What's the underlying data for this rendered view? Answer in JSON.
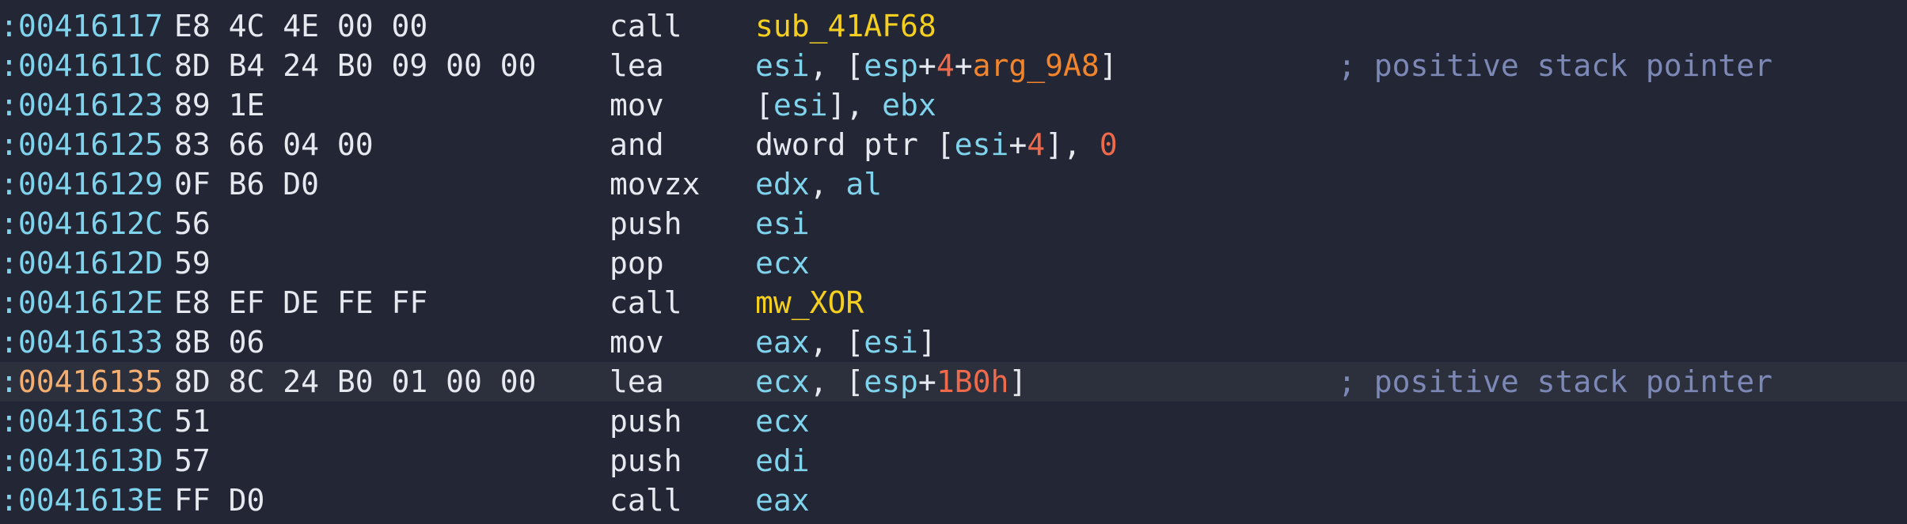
{
  "colors": {
    "background": "#232634",
    "highlight_row": "#2c303d",
    "address": "#7fd3ec",
    "address_current": "#f4ae71",
    "text": "#e7e9f0",
    "register": "#7fd3ec",
    "number": "#ee6a4b",
    "symbol": "#f4cf1f",
    "argument": "#f2842c",
    "comment": "#7c88b5"
  },
  "lines": [
    {
      "colon": ":",
      "address": "00416117",
      "bytes": "E8 4C 4E 00 00",
      "mnemonic": "call",
      "operands": [
        {
          "text": "sub_41AF68",
          "kind": "sym"
        }
      ],
      "comment": ""
    },
    {
      "colon": ":",
      "address": "0041611C",
      "bytes": "8D B4 24 B0 09 00 00",
      "mnemonic": "lea",
      "operands": [
        {
          "text": "esi",
          "kind": "reg"
        },
        {
          "text": ", [",
          "kind": "plain"
        },
        {
          "text": "esp",
          "kind": "reg"
        },
        {
          "text": "+",
          "kind": "plain"
        },
        {
          "text": "4",
          "kind": "num"
        },
        {
          "text": "+",
          "kind": "plain"
        },
        {
          "text": "arg_9A8",
          "kind": "arg"
        },
        {
          "text": "]",
          "kind": "plain"
        }
      ],
      "comment": "; positive stack pointer"
    },
    {
      "colon": ":",
      "address": "00416123",
      "bytes": "89 1E",
      "mnemonic": "mov",
      "operands": [
        {
          "text": "[",
          "kind": "plain"
        },
        {
          "text": "esi",
          "kind": "reg"
        },
        {
          "text": "], ",
          "kind": "plain"
        },
        {
          "text": "ebx",
          "kind": "reg"
        }
      ],
      "comment": ""
    },
    {
      "colon": ":",
      "address": "00416125",
      "bytes": "83 66 04 00",
      "mnemonic": "and",
      "operands": [
        {
          "text": "dword ptr [",
          "kind": "plain"
        },
        {
          "text": "esi",
          "kind": "reg"
        },
        {
          "text": "+",
          "kind": "plain"
        },
        {
          "text": "4",
          "kind": "num"
        },
        {
          "text": "], ",
          "kind": "plain"
        },
        {
          "text": "0",
          "kind": "num"
        }
      ],
      "comment": ""
    },
    {
      "colon": ":",
      "address": "00416129",
      "bytes": "0F B6 D0",
      "mnemonic": "movzx",
      "operands": [
        {
          "text": "edx",
          "kind": "reg"
        },
        {
          "text": ", ",
          "kind": "plain"
        },
        {
          "text": "al",
          "kind": "reg"
        }
      ],
      "comment": ""
    },
    {
      "colon": ":",
      "address": "0041612C",
      "bytes": "56",
      "mnemonic": "push",
      "operands": [
        {
          "text": "esi",
          "kind": "reg"
        }
      ],
      "comment": ""
    },
    {
      "colon": ":",
      "address": "0041612D",
      "bytes": "59",
      "mnemonic": "pop",
      "operands": [
        {
          "text": "ecx",
          "kind": "reg"
        }
      ],
      "comment": ""
    },
    {
      "colon": ":",
      "address": "0041612E",
      "bytes": "E8 EF DE FE FF",
      "mnemonic": "call",
      "operands": [
        {
          "text": "mw_XOR",
          "kind": "sym"
        }
      ],
      "comment": ""
    },
    {
      "colon": ":",
      "address": "00416133",
      "bytes": "8B 06",
      "mnemonic": "mov",
      "operands": [
        {
          "text": "eax",
          "kind": "reg"
        },
        {
          "text": ", [",
          "kind": "plain"
        },
        {
          "text": "esi",
          "kind": "reg"
        },
        {
          "text": "]",
          "kind": "plain"
        }
      ],
      "comment": ""
    },
    {
      "colon": ":",
      "address": "00416135",
      "bytes": "8D 8C 24 B0 01 00 00",
      "mnemonic": "lea",
      "current": true,
      "operands": [
        {
          "text": "ecx",
          "kind": "reg"
        },
        {
          "text": ", [",
          "kind": "plain"
        },
        {
          "text": "esp",
          "kind": "reg"
        },
        {
          "text": "+",
          "kind": "plain"
        },
        {
          "text": "1B0h",
          "kind": "num"
        },
        {
          "text": "]",
          "kind": "plain"
        }
      ],
      "comment": "; positive stack pointer"
    },
    {
      "colon": ":",
      "address": "0041613C",
      "bytes": "51",
      "mnemonic": "push",
      "operands": [
        {
          "text": "ecx",
          "kind": "reg"
        }
      ],
      "comment": ""
    },
    {
      "colon": ":",
      "address": "0041613D",
      "bytes": "57",
      "mnemonic": "push",
      "operands": [
        {
          "text": "edi",
          "kind": "reg"
        }
      ],
      "comment": ""
    },
    {
      "colon": ":",
      "address": "0041613E",
      "bytes": "FF D0",
      "mnemonic": "call",
      "operands": [
        {
          "text": "eax",
          "kind": "reg"
        }
      ],
      "comment": ""
    }
  ]
}
